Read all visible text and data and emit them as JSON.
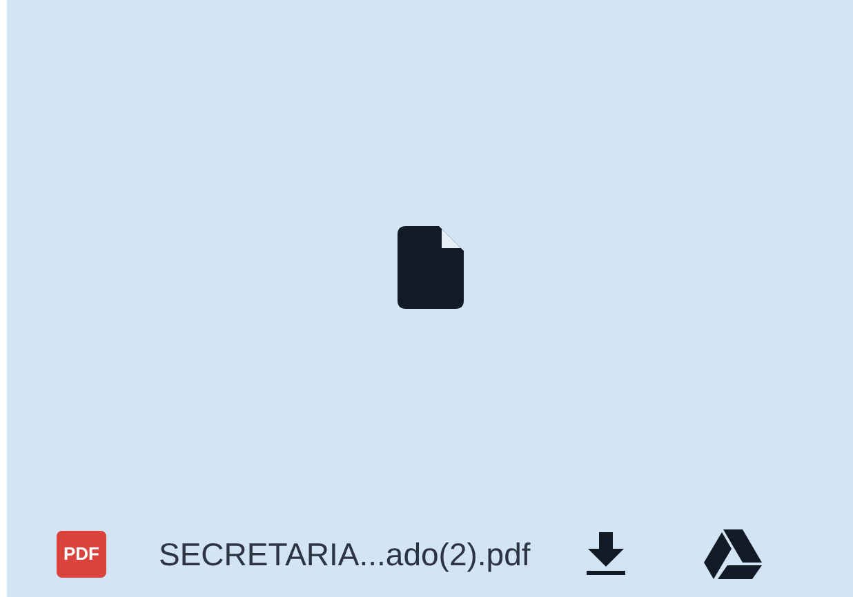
{
  "file_type_badge": "PDF",
  "file_name": "SECRETARIA...ado(2).pdf"
}
